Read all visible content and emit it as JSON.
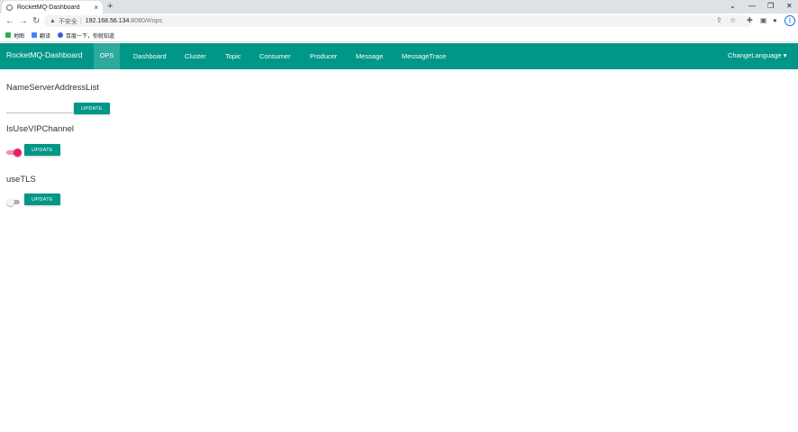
{
  "browser": {
    "tab_title": "RocketMQ-Dashboard",
    "new_tab": "+",
    "close_tab": "×",
    "url_insecure": "不安全",
    "url_host": "192.168.56.134",
    "url_path": ":8080/#/ops",
    "window_controls": [
      "⌄",
      "—",
      "❐",
      "✕"
    ],
    "bookmarks": [
      {
        "label": "地图",
        "color": "#34a853"
      },
      {
        "label": "翻译",
        "color": "#4285f4"
      },
      {
        "label": "百度一下，你就知道",
        "color": "#3b5bdb"
      }
    ]
  },
  "nav": {
    "brand": "RocketMQ-Dashboard",
    "items": [
      "OPS",
      "Dashboard",
      "Cluster",
      "Topic",
      "Consumer",
      "Producer",
      "Message",
      "MessageTrace"
    ],
    "active": "OPS",
    "language": "ChangeLanguage ▾"
  },
  "ops": {
    "nameserver": {
      "title": "NameServerAddressList",
      "value": "",
      "button": "UPDATE"
    },
    "vip_channel": {
      "title": "IsUseVIPChannel",
      "enabled": true,
      "button": "UPDATE"
    },
    "tls": {
      "title": "useTLS",
      "enabled": false,
      "button": "UPDATE"
    }
  },
  "colors": {
    "primary": "#009688",
    "toggle_on": "#e91e63"
  }
}
